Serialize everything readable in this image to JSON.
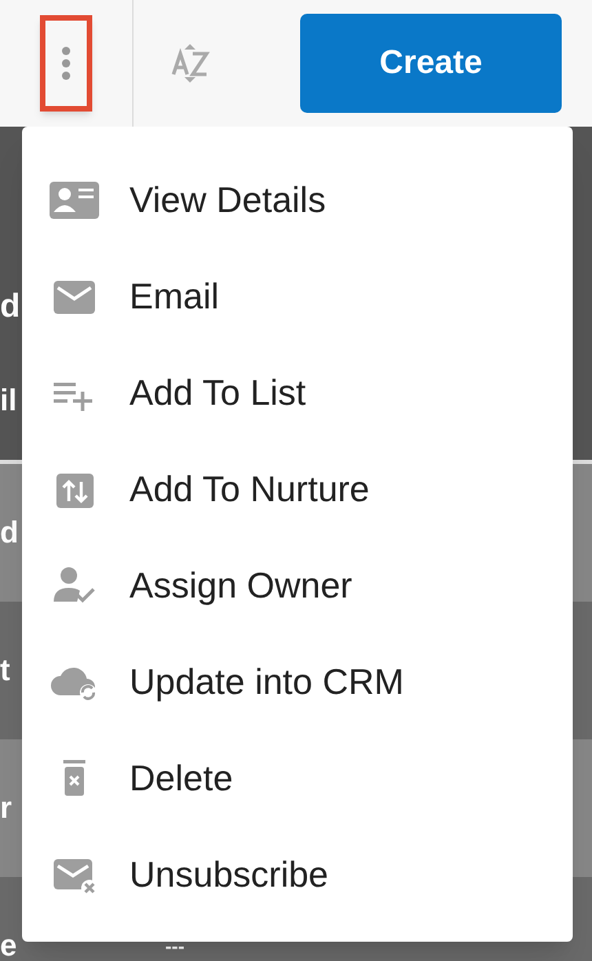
{
  "toolbar": {
    "create_button": "Create"
  },
  "background_rows": [
    {
      "text": "d",
      "kind": "header"
    },
    {
      "text": "il",
      "kind": "header"
    },
    {
      "text": "d",
      "kind": "light"
    },
    {
      "text": "t",
      "kind": "dark"
    },
    {
      "text": "r",
      "kind": "light"
    },
    {
      "text": "e",
      "kind": "dark"
    }
  ],
  "background_dash": "---",
  "menu": {
    "items": [
      {
        "label": "View Details"
      },
      {
        "label": "Email"
      },
      {
        "label": "Add To List"
      },
      {
        "label": "Add To Nurture"
      },
      {
        "label": "Assign Owner"
      },
      {
        "label": "Update into CRM"
      },
      {
        "label": "Delete"
      },
      {
        "label": "Unsubscribe"
      }
    ]
  }
}
